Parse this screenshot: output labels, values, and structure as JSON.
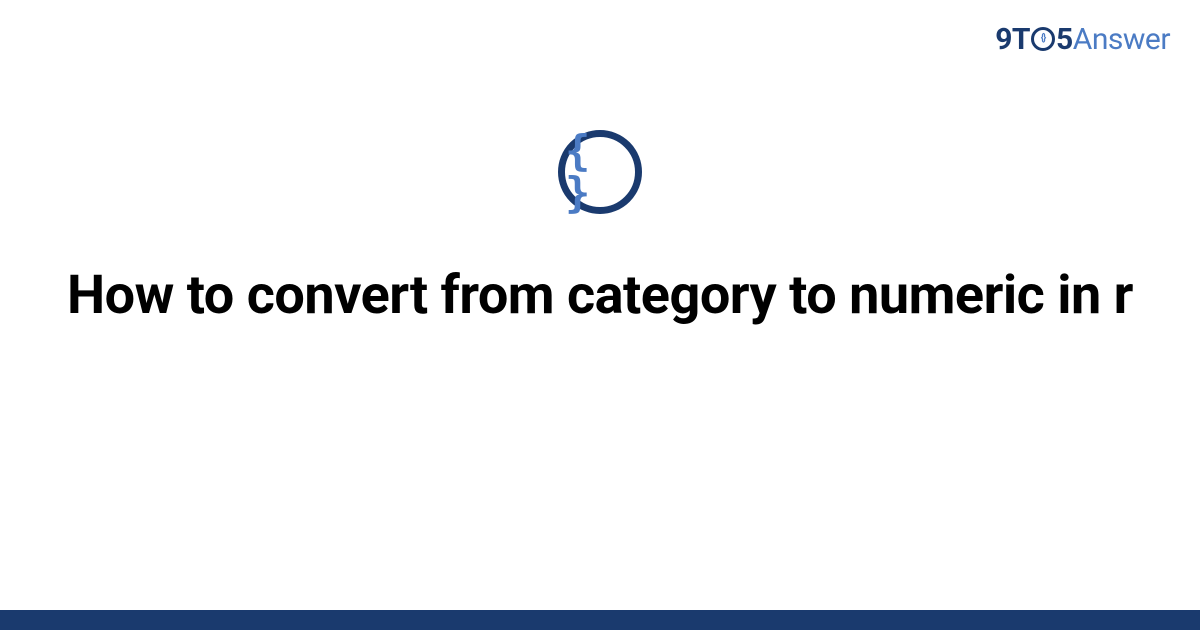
{
  "brand": {
    "part1": "9T",
    "o_inner": "{}",
    "part2": "5",
    "part3": "Answer"
  },
  "category_icon": {
    "name": "braces-icon",
    "glyph": "{ }"
  },
  "title": "How to convert from category to numeric in r",
  "colors": {
    "primary_dark": "#1a3a6e",
    "primary_light": "#4b7bc4"
  }
}
